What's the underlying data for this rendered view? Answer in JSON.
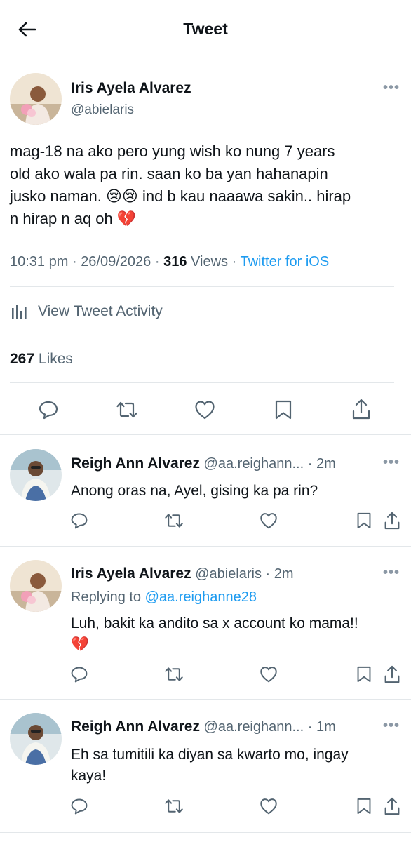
{
  "header": {
    "title": "Tweet"
  },
  "main_tweet": {
    "name": "Iris Ayela Alvarez",
    "handle": "@abielaris",
    "text_lines": [
      "mag-18 na ako pero yung wish ko nung 7 years",
      "old ako wala pa rin. saan ko ba yan hahanapin",
      "jusko naman. 😢😢 ind b kau naaawa sakin.. hirap",
      "n hirap n aq oh 💔"
    ],
    "time": "10:31 pm",
    "date": "26/09/2026",
    "views_count": "316",
    "views_label": "Views",
    "client": "Twitter for iOS",
    "activity_label": "View Tweet Activity",
    "likes_count": "267",
    "likes_label": "Likes"
  },
  "replies": [
    {
      "name": "Reigh Ann Alvarez",
      "handle": "@aa.reighann...",
      "time": "2m",
      "text_lines": [
        "Anong oras na, Ayel, gising ka pa rin?"
      ]
    },
    {
      "name": "Iris Ayela Alvarez",
      "handle": "@abielaris",
      "time": "2m",
      "replying_prefix": "Replying to",
      "replying_to": "@aa.reighanne28",
      "text_lines": [
        "Luh, bakit ka andito sa x account ko mama!!",
        "💔"
      ]
    },
    {
      "name": "Reigh Ann Alvarez",
      "handle": "@aa.reighann...",
      "time": "1m",
      "text_lines": [
        "Eh sa tumitili ka diyan sa kwarto mo, ingay",
        "kaya!"
      ]
    }
  ],
  "separator_dot": "·",
  "more_glyph": "•••",
  "colors": {
    "link": "#1d9bf0",
    "secondary_text": "#536471",
    "divider": "#e3e7ea"
  },
  "icons": [
    "back-arrow-icon",
    "more-icon",
    "activity-chart-icon",
    "reply-icon",
    "retweet-icon",
    "like-icon",
    "bookmark-icon",
    "share-icon"
  ]
}
